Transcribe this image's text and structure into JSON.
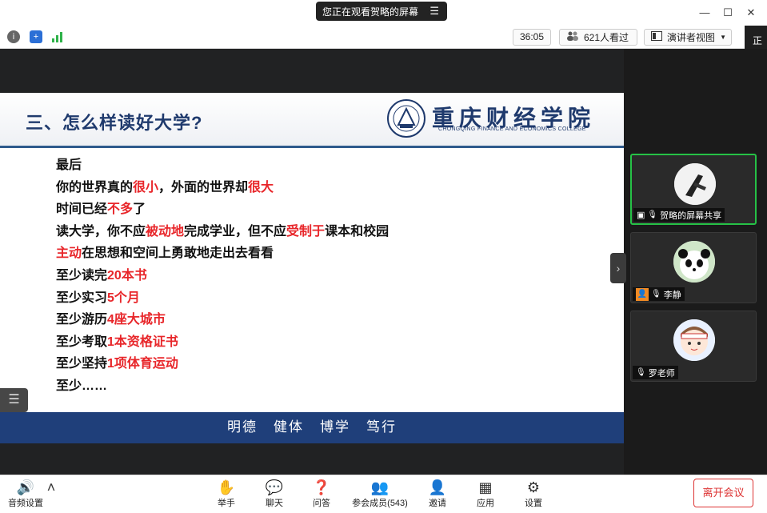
{
  "titlebar": {
    "share_notice": "您正在观看贺略的屏幕",
    "menu_icon": "hamburger-icon",
    "min": "—",
    "max": "☐",
    "close": "✕"
  },
  "toolbar": {
    "timer": "36:05",
    "viewers": "621人看过",
    "view_mode": "演讲者视图",
    "corner_text": "正在"
  },
  "slide": {
    "title": "三、怎么样读好大学?",
    "school_cn": "重庆财经学院",
    "school_en": "CHONGQING FINANCE AND ECONOMICS COLLEGE",
    "lines": [
      [
        {
          "t": "最后",
          "r": false
        }
      ],
      [
        {
          "t": "你的世界真的",
          "r": false
        },
        {
          "t": "很小",
          "r": true
        },
        {
          "t": "，外面的世界却",
          "r": false
        },
        {
          "t": "很大",
          "r": true
        }
      ],
      [
        {
          "t": "时间已经",
          "r": false
        },
        {
          "t": "不多",
          "r": true
        },
        {
          "t": "了",
          "r": false
        }
      ],
      [
        {
          "t": "读大学，你不应",
          "r": false
        },
        {
          "t": "被动地",
          "r": true
        },
        {
          "t": "完成学业，但不应",
          "r": false
        },
        {
          "t": "受制于",
          "r": true
        },
        {
          "t": "课本和校园",
          "r": false
        }
      ],
      [
        {
          "t": "主动",
          "r": true
        },
        {
          "t": "在思想和空间上勇敢地走出去看看",
          "r": false
        }
      ],
      [
        {
          "t": "至少读完",
          "r": false
        },
        {
          "t": "20本书",
          "r": true
        }
      ],
      [
        {
          "t": "至少实习",
          "r": false
        },
        {
          "t": "5个月",
          "r": true
        }
      ],
      [
        {
          "t": "至少游历",
          "r": false
        },
        {
          "t": "4座大城市",
          "r": true
        }
      ],
      [
        {
          "t": "至少考取",
          "r": false
        },
        {
          "t": "1本资格证书",
          "r": true
        }
      ],
      [
        {
          "t": "至少坚持",
          "r": false
        },
        {
          "t": "1项体育运动",
          "r": true
        }
      ],
      [
        {
          "t": "至少……",
          "r": false
        }
      ]
    ],
    "motto": [
      "明德",
      "健体",
      "博学",
      "笃行"
    ]
  },
  "participants": [
    {
      "name": "贺略的屏幕共享",
      "active": true
    },
    {
      "name": "李静",
      "active": false
    },
    {
      "name": "罗老师",
      "active": false
    }
  ],
  "bottombar": {
    "audio": "音频设置",
    "raise_hand": "举手",
    "chat": "聊天",
    "qa": "问答",
    "members": "参会成员(543)",
    "invite": "邀请",
    "apps": "应用",
    "settings": "设置",
    "leave": "离开会议"
  },
  "colors": {
    "accent_red": "#e8262a",
    "navy": "#1f3f7a",
    "active_green": "#26c146"
  }
}
